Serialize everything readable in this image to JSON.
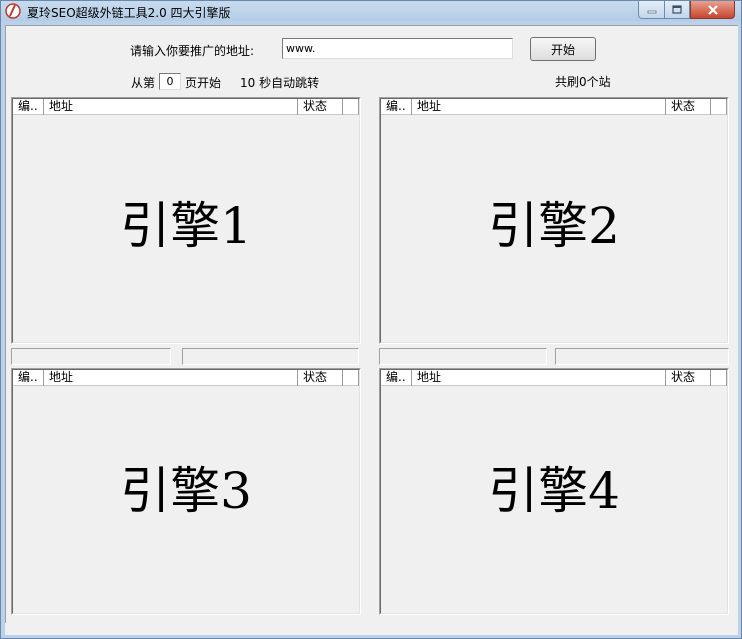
{
  "window": {
    "title": "夏玲SEO超级外链工具2.0 四大引擎版"
  },
  "form": {
    "url_label": "请输入你要推广的地址:",
    "url_value": "www.",
    "start_button": "开始",
    "from_label": "从第",
    "page_value": "0",
    "page_suffix": "页开始",
    "jump_text": "10 秒自动跳转",
    "total_text": "共刷0个站"
  },
  "columns": [
    "编..",
    "地址",
    "状态"
  ],
  "engines": [
    {
      "label": "引擎1"
    },
    {
      "label": "引擎2"
    },
    {
      "label": "引擎3"
    },
    {
      "label": "引擎4"
    }
  ],
  "icons": {
    "app": "app-logo-icon",
    "minimize": "minimize-icon",
    "maximize": "maximize-icon",
    "close": "close-icon"
  }
}
